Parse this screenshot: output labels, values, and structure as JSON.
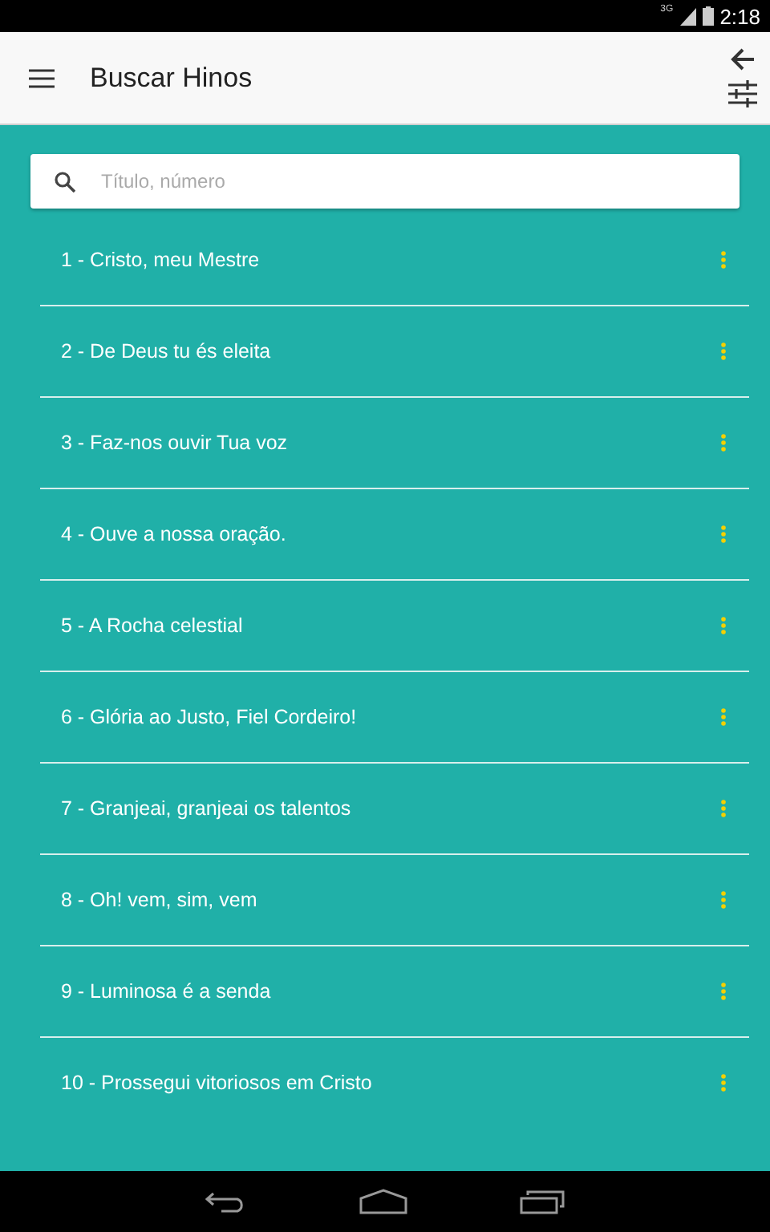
{
  "status_bar": {
    "network": "3G",
    "time": "2:18"
  },
  "toolbar": {
    "title": "Buscar Hinos"
  },
  "search": {
    "placeholder": "Título, número"
  },
  "hymns": [
    {
      "title": "1 - Cristo, meu Mestre"
    },
    {
      "title": "2 - De Deus tu és eleita"
    },
    {
      "title": "3 - Faz-nos ouvir Tua voz"
    },
    {
      "title": "4 - Ouve a nossa oração."
    },
    {
      "title": "5 - A Rocha celestial"
    },
    {
      "title": "6 - Glória ao Justo, Fiel Cordeiro!"
    },
    {
      "title": "7 - Granjeai, granjeai os talentos"
    },
    {
      "title": "8 - Oh! vem, sim, vem"
    },
    {
      "title": "9 - Luminosa é a senda"
    },
    {
      "title": "10 - Prossegui vitoriosos em Cristo"
    }
  ]
}
